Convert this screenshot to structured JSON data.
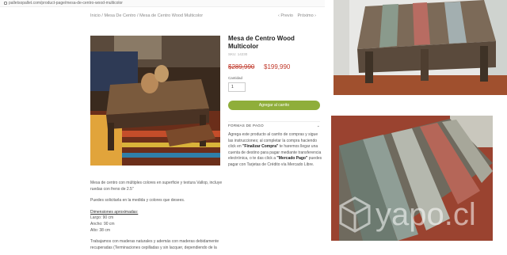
{
  "browser": {
    "url": "palletsopallet.com/product-page/mesa-de-centro-wood-multicolor"
  },
  "breadcrumb": {
    "home": "Inicio",
    "category": "Mesa De Centro",
    "current": "Mesa de Centro Wood Multicolor"
  },
  "pager": {
    "prev": "‹ Previo",
    "next": "Próximo ›"
  },
  "product": {
    "title": "Mesa de Centro Wood Multicolor",
    "sku": "SKU: 14230",
    "price_old": "$289,990",
    "price_new": "$199,990",
    "qty_label": "Cantidad",
    "qty_value": "1",
    "add_button": "Agregar al carrito",
    "formas_label": "FORMAS DE PAGO",
    "pay_1": "Agrega este producto al carrito de compras y sigue las instrucciones; al completar la compra haciendo click en ",
    "pay_finalizar": "\"Finalizar Compra\"",
    "pay_2": " te haremos llegar una cuenta de destino para pagar mediante transferencia electrónica, o te das click a ",
    "pay_mercado": "\"Mercado Pago\"",
    "pay_3": " puedes pagar con Tarjetas de Crédito vía Mercado Libre."
  },
  "description": {
    "p1": "Mesa de centro con múltiples colores en superficie y textura Vallop, incluye ruedas con freno de 2.5\"",
    "p2": "Puedes solicitarla en la medida y colores que desees.",
    "dim_title": "Dimensiones aproximadas:",
    "largo": "Largo: 90 cm",
    "ancho": "Ancho: 90 cm",
    "alto": "Alto: 38 cm",
    "p3": "Trabajamos con maderas naturales y además con maderas debidamente recuperadas (Terminaciones cepilladas y sin lacquer, dependiendo de la"
  },
  "watermark": {
    "text": "yapo.cl"
  },
  "colors": {
    "button_green": "#8fae3a",
    "price_red": "#c0392b"
  }
}
